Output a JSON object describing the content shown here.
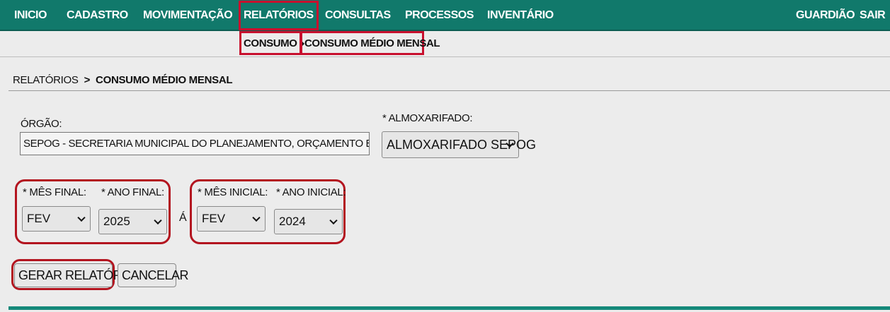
{
  "nav": {
    "items": [
      "INICIO",
      "CADASTRO",
      "MOVIMENTAÇÃO",
      "RELATÓRIOS",
      "CONSULTAS",
      "PROCESSOS",
      "INVENTÁRIO"
    ],
    "right_items": [
      "GUARDIÃO",
      "SAIR"
    ]
  },
  "subnav": {
    "consumo": "CONSUMO",
    "consumo_medio": "CONSUMO MÉDIO MENSAL"
  },
  "breadcrumb": {
    "root": "RELATÓRIOS",
    "separator": ">",
    "current": "CONSUMO MÉDIO MENSAL"
  },
  "form": {
    "orgao_label": "ÓRGÃO:",
    "orgao_value": "SEPOG - SECRETARIA MUNICIPAL DO PLANEJAMENTO, ORÇAMENTO E GESTÃO",
    "almox_label": "* ALMOXARIFADO:",
    "almox_value": "ALMOXARIFADO SEPOG",
    "mes_final_label": "* MÊS FINAL:",
    "mes_final_value": "FEV",
    "ano_final_label": "* ANO FINAL:",
    "ano_final_value": "2025",
    "a_label": "Á",
    "mes_inicial_label": "* MÊS INICIAL:",
    "mes_inicial_value": "FEV",
    "ano_inicial_label": "* ANO INICIAL:",
    "ano_inicial_value": "2024"
  },
  "buttons": {
    "gerar": "GERAR RELATÓRIO",
    "cancelar": "CANCELAR"
  },
  "colors": {
    "nav_bg": "#11796b",
    "highlight": "#b3141f"
  }
}
